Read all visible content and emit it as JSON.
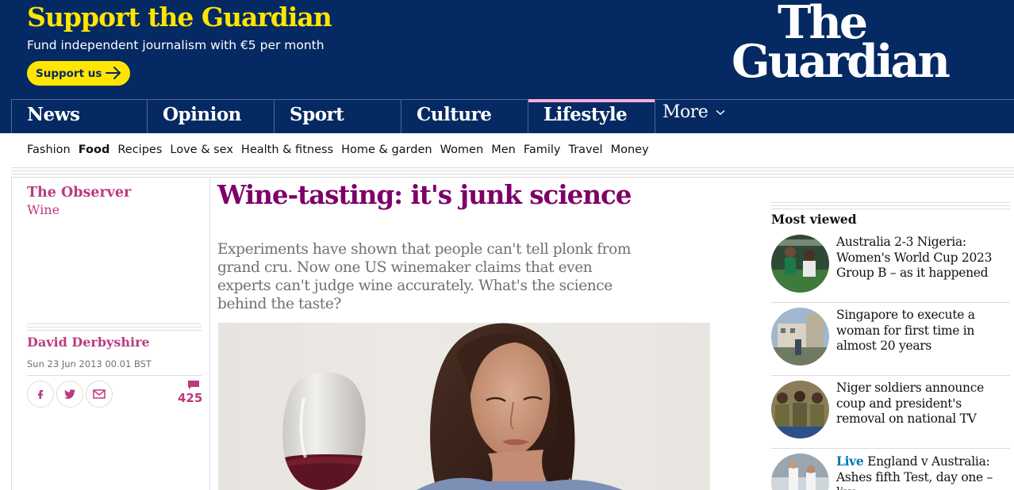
{
  "support": {
    "title": "Support the Guardian",
    "subtitle": "Fund independent journalism with €5 per month",
    "button_label": "Support us"
  },
  "logo": {
    "line1": "The",
    "line2": "Guardian"
  },
  "pillars": [
    {
      "label": "News"
    },
    {
      "label": "Opinion"
    },
    {
      "label": "Sport"
    },
    {
      "label": "Culture"
    },
    {
      "label": "Lifestyle",
      "active": true
    },
    {
      "label": "More"
    }
  ],
  "subnav": [
    {
      "label": "Fashion"
    },
    {
      "label": "Food",
      "active": true
    },
    {
      "label": "Recipes"
    },
    {
      "label": "Love & sex"
    },
    {
      "label": "Health & fitness"
    },
    {
      "label": "Home & garden"
    },
    {
      "label": "Women"
    },
    {
      "label": "Men"
    },
    {
      "label": "Family"
    },
    {
      "label": "Travel"
    },
    {
      "label": "Money"
    }
  ],
  "article": {
    "series": "The Observer",
    "section": "Wine",
    "headline": "Wine-tasting: it's junk science",
    "standfirst": "Experiments have shown that people can't tell plonk from grand cru. Now one US winemaker claims that even experts can't judge wine accurately. What's the science behind the taste?",
    "byline": "David Derbyshire",
    "date": "Sun 23 Jun 2013 00.01 BST",
    "comment_count": "425",
    "share_icons": [
      "facebook-icon",
      "twitter-icon",
      "email-icon"
    ]
  },
  "most_viewed": {
    "title": "Most viewed",
    "items": [
      {
        "text": "Australia 2-3 Nigeria: Women's World Cup 2023 Group B – as it happened",
        "live": ""
      },
      {
        "text": "Singapore to execute a woman for first time in almost 20 years",
        "live": ""
      },
      {
        "text": "Niger soldiers announce coup and president's removal on national TV",
        "live": ""
      },
      {
        "text": "England v Australia: Ashes fifth Test, day one – live",
        "live": "Live"
      }
    ]
  },
  "colors": {
    "brand": "#052962",
    "support_yellow": "#ffe500",
    "lifestyle": "#7d0068",
    "lifestyle_accent": "#bb3b80",
    "lifestyle_pillar_bar": "#ffabdb",
    "live_blue": "#0077b6"
  }
}
